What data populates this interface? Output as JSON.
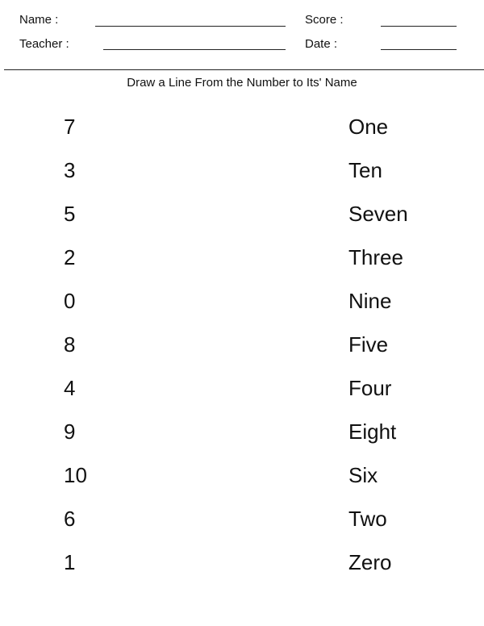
{
  "header": {
    "name_label": "Name :",
    "teacher_label": "Teacher :",
    "score_label": "Score :",
    "date_label": "Date :"
  },
  "instruction": "Draw a Line From the Number to Its' Name",
  "numbers": [
    "7",
    "3",
    "5",
    "2",
    "0",
    "8",
    "4",
    "9",
    "10",
    "6",
    "1"
  ],
  "words": [
    "One",
    "Ten",
    "Seven",
    "Three",
    "Nine",
    "Five",
    "Four",
    "Eight",
    "Six",
    "Two",
    "Zero"
  ]
}
